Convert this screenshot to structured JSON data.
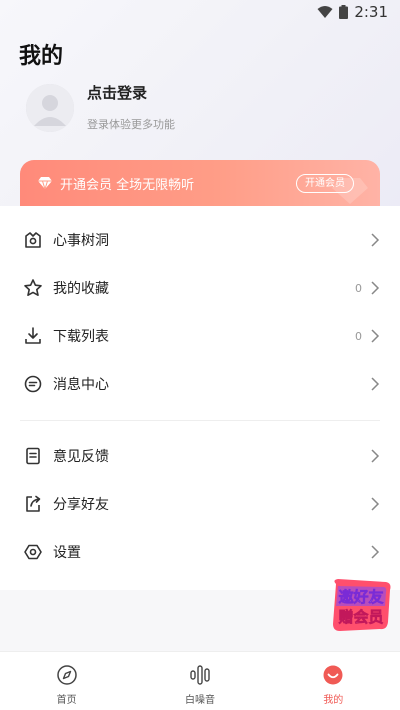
{
  "status_bar": {
    "time": "2:31",
    "icons": [
      "wifi-icon",
      "battery-icon"
    ]
  },
  "page_title": "我的",
  "profile": {
    "login_title": "点击登录",
    "login_subtitle": "登录体验更多功能",
    "avatar_icon": "default-avatar-icon"
  },
  "vip": {
    "icon": "diamond-icon",
    "text": "开通会员 全场无限畅听",
    "button": "开通会员",
    "color_start": "#ff8a7a",
    "color_end": "#ffb3a6"
  },
  "menu": {
    "group1": [
      {
        "icon": "treehole-icon",
        "label": "心事树洞",
        "count": ""
      },
      {
        "icon": "star-icon",
        "label": "我的收藏",
        "count": "0"
      },
      {
        "icon": "download-icon",
        "label": "下载列表",
        "count": "0"
      },
      {
        "icon": "message-icon",
        "label": "消息中心",
        "count": ""
      }
    ],
    "group2": [
      {
        "icon": "feedback-icon",
        "label": "意见反馈",
        "count": ""
      },
      {
        "icon": "share-icon",
        "label": "分享好友",
        "count": ""
      },
      {
        "icon": "settings-icon",
        "label": "设置",
        "count": ""
      }
    ]
  },
  "invite_badge": {
    "line1": "邀好友",
    "line2": "赠会员"
  },
  "tabs": [
    {
      "icon": "compass-icon",
      "label": "首页",
      "active": false
    },
    {
      "icon": "white-noise-icon",
      "label": "白噪音",
      "active": false
    },
    {
      "icon": "profile-smile-icon",
      "label": "我的",
      "active": true
    }
  ],
  "colors": {
    "accent": "#f05a55",
    "vip": "#ff9d87"
  }
}
